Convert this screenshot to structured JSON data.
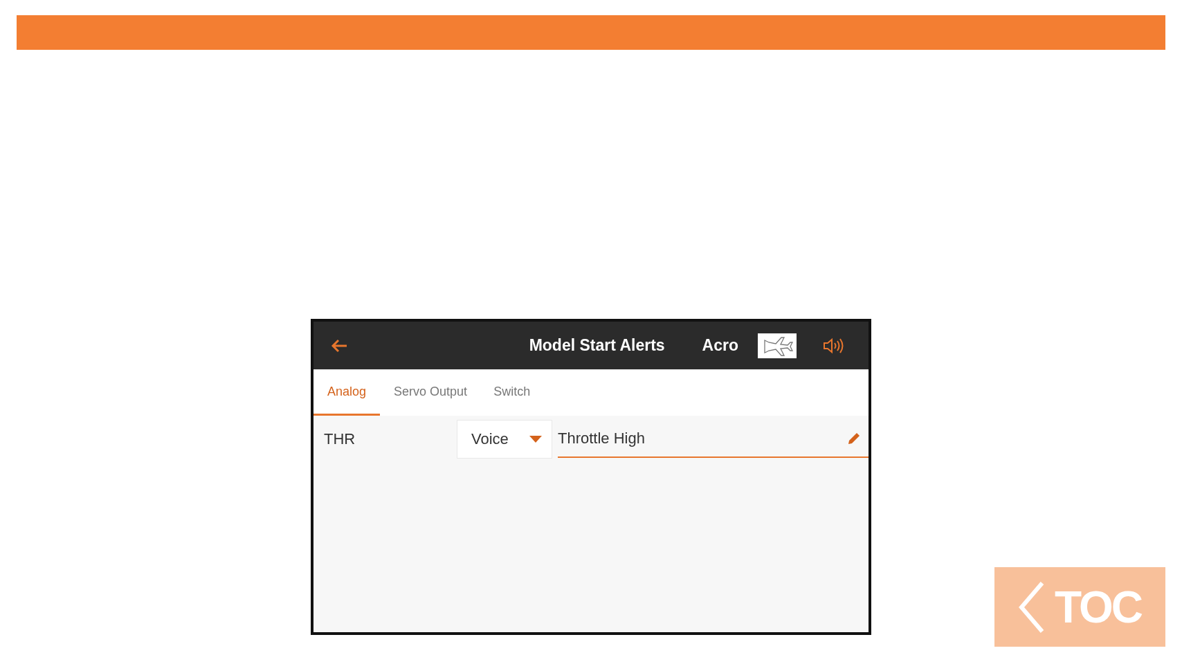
{
  "header": {
    "title": "Model Start Alerts",
    "mode": "Acro"
  },
  "tabs": [
    {
      "label": "Analog",
      "selected": true
    },
    {
      "label": "Servo Output",
      "selected": false
    },
    {
      "label": "Switch",
      "selected": false
    }
  ],
  "alerts": [
    {
      "channel": "THR",
      "type": "Voice",
      "message": "Throttle High"
    }
  ],
  "toc_button": {
    "label": "TOC"
  }
}
